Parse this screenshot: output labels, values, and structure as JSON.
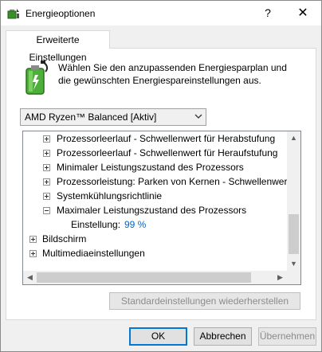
{
  "window": {
    "title": "Energieoptionen",
    "help_glyph": "?",
    "close_glyph": "✕"
  },
  "tab": {
    "label": "Erweiterte Einstellungen"
  },
  "description": "Wählen Sie den anzupassenden Energiesparplan und die gewünschten Energiespareinstellungen aus.",
  "plan_select": {
    "value": "AMD Ryzen™ Balanced [Aktiv]"
  },
  "tree": {
    "items": [
      {
        "label": "Prozessorleerlauf - Schwellenwert für Herabstufung",
        "expander": "+"
      },
      {
        "label": "Prozessorleerlauf - Schwellenwert für Heraufstufung",
        "expander": "+"
      },
      {
        "label": "Minimaler Leistungszustand des Prozessors",
        "expander": "+"
      },
      {
        "label": "Prozessorleistung: Parken von Kernen - Schwellenwert für",
        "expander": "+"
      },
      {
        "label": "Systemkühlungsrichtlinie",
        "expander": "+"
      },
      {
        "label": "Maximaler Leistungszustand des Prozessors",
        "expander": "−"
      },
      {
        "setting_label": "Einstellung:",
        "setting_value": "99 %"
      },
      {
        "label": "Bildschirm",
        "expander": "+"
      },
      {
        "label": "Multimediaeinstellungen",
        "expander": "+"
      }
    ]
  },
  "buttons": {
    "restore": "Standardeinstellungen wiederherstellen",
    "ok": "OK",
    "cancel": "Abbrechen",
    "apply": "Übernehmen"
  },
  "colors": {
    "accent": "#0078d7",
    "value_blue": "#0066cc"
  }
}
